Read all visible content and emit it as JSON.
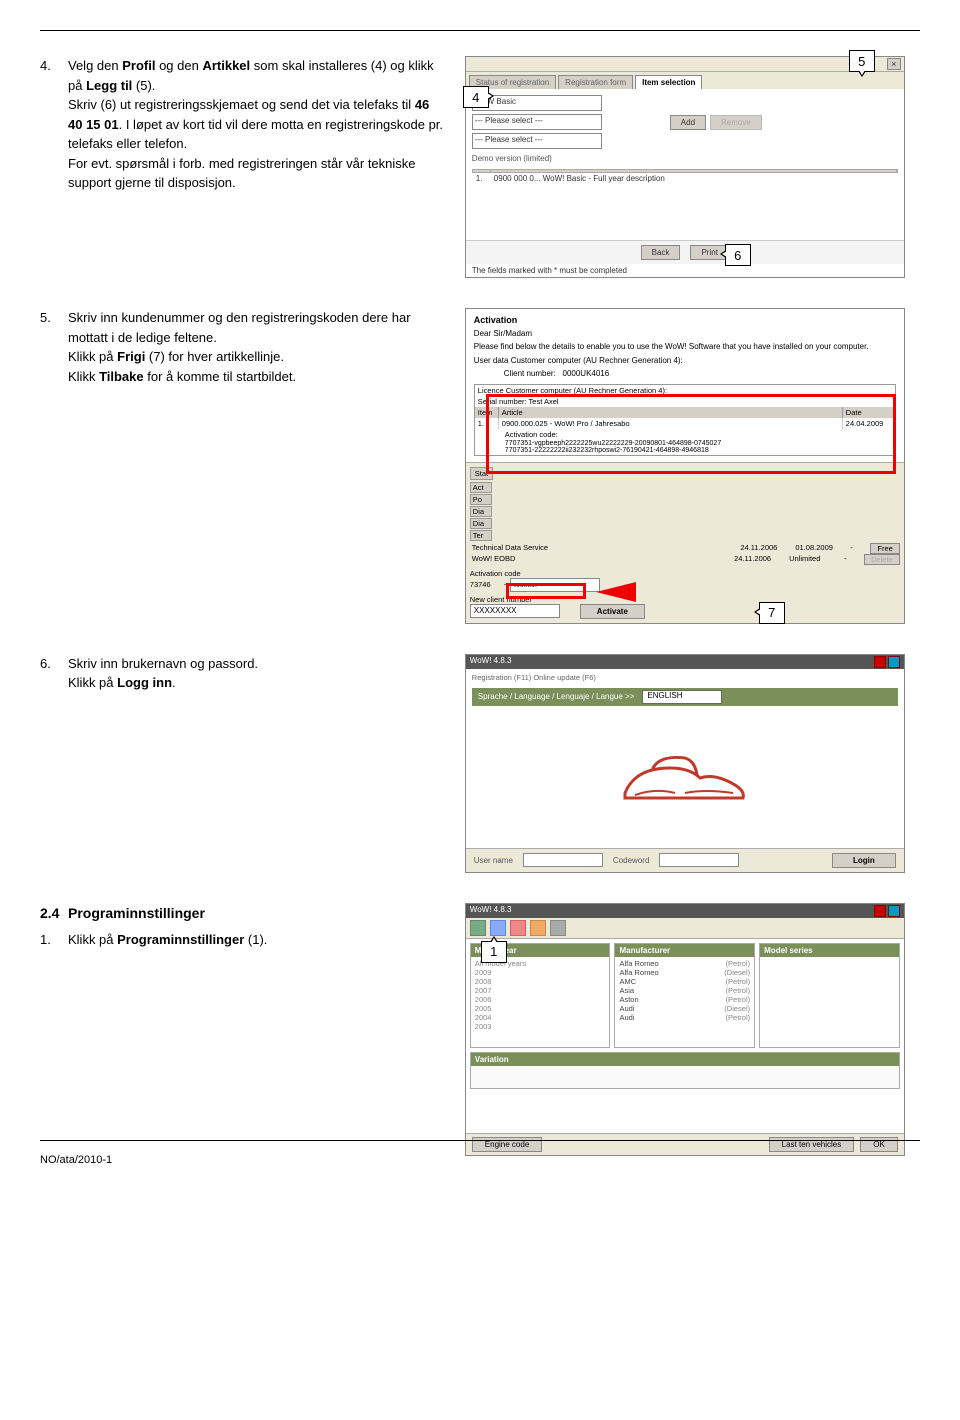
{
  "step4": {
    "num": "4.",
    "text_pre": "Velg den ",
    "b1": "Profil",
    "mid1": " og den ",
    "b2": "Artikkel",
    "mid2": " som skal installeres (4) og klikk på ",
    "b3": "Legg til",
    "mid3": " (5).",
    "line2a": "Skriv (6) ut registreringsskjemaet og send det via telefaks til ",
    "b4": "46 40 15 01",
    "line2b": ". I løpet av kort tid vil dere motta en registreringskode pr. telefaks eller telefon.",
    "line3": "For evt. spørsmål i forb. med registreringen står vår tekniske support gjerne til disposisjon."
  },
  "shot1": {
    "tab1": "Status of registration",
    "tab2": "Registration form",
    "tab3": "Item selection",
    "sel1": "WoW Basic",
    "sel2": "--- Please select ---",
    "sel3": "--- Please select ---",
    "demo": "Demo version (limited)",
    "add": "Add",
    "remove": "Remove",
    "th_idx": "",
    "th_art": "0900 000 0... WoW! Basic - Full year description",
    "idx1": "1.",
    "back": "Back",
    "print": "Print",
    "note": "The fields marked with * must be completed",
    "c4": "4",
    "c5": "5",
    "c6": "6"
  },
  "step5": {
    "num": "5.",
    "line1": "Skriv inn kundenummer og den registreringskoden dere har mottatt i de ledige feltene.",
    "line2a": "Klikk på ",
    "b1": "Frigi",
    "line2b": " (7) for hver artikkellinje.",
    "line3a": "Klikk ",
    "b2": "Tilbake",
    "line3b": " for å komme til startbildet."
  },
  "shot2": {
    "title": "Activation",
    "greet": "Dear Sir/Madam",
    "p1": "Please find below the details to enable you to use the WoW! Software that you have installed on your computer.",
    "p2": "User data Customer computer (AU Rechner Generation 4):",
    "clientnum_l": "Client number:",
    "clientnum_v": "0000UK4016",
    "lic": "Licence Customer computer (AU Rechner Generation 4):",
    "serial": "Serial number: Test Axel",
    "th_item": "Item",
    "th_art": "Article",
    "th_date": "Date",
    "row1_i": "1.",
    "row1_a": "0900.000.025 - WoW! Pro / Jahresabo",
    "row1_d": "24.04.2009",
    "actcode_l": "Activation code:",
    "actcode1": "7707351-vgpbeeph2222225wu22222229-20090801-464898-0745027",
    "actcode2": "7707351-22222222ii232232rhposwi2-76190421-464898-4946818",
    "greytab_stat": "Stat",
    "greytab_act": "Act",
    "greytab_po": "Po",
    "greytab_dia": "Dia",
    "greytab_dia2": "Dia",
    "greytab_ter": "Ter",
    "row_tds": "Technical Data Service",
    "row_tds_d1": "24.11.2006",
    "row_tds_d2": "01.08.2009",
    "row_tds_d3": "-",
    "row_wow": "WoW! EOBD",
    "row_wow_d1": "24.11.2006",
    "row_wow_d2": "Unlimited",
    "row_wow_d3": "-",
    "activation_l": "Activation code",
    "act_val": "73746",
    "xxxxx": "xxxxxx",
    "newnum": "New client number",
    "newnum_v": "XXXXXXXX",
    "activate": "Activate",
    "c7": "7",
    "freebtn": "Free",
    "delbtn": "Delete"
  },
  "step6": {
    "num": "6.",
    "line1": "Skriv inn brukernavn og passord.",
    "line2a": "Klikk på ",
    "b1": "Logg inn",
    "line2b": "."
  },
  "shot3": {
    "tb": "WoW! 4.8.3",
    "crumb": "Registration (F11) Online update (F6)",
    "langlabel": "Sprache / Language / Lenguaje / Langue >>",
    "langval": "ENGLISH",
    "user": "User name",
    "code": "Codeword",
    "login": "Login"
  },
  "sec24": {
    "numhead": "2.4",
    "head": "Programinnstillinger",
    "num": "1.",
    "line_a": "Klikk på ",
    "b1": "Programinnstillinger",
    "line_b": " (1)."
  },
  "shot4": {
    "tb": "WoW! 4.8.3",
    "c1": "1",
    "col1h": "Model year",
    "col2h": "Manufacturer",
    "col3h": "Model series",
    "col4h": "Variation",
    "y_all": "All model years",
    "years": [
      "2009",
      "2008",
      "2007",
      "2006",
      "2005",
      "2004",
      "2003"
    ],
    "mfr": [
      [
        "Alfa Romeo",
        "(Petrol)"
      ],
      [
        "Alfa Romeo",
        "(Diesel)"
      ],
      [
        "AMC",
        "(Petrol)"
      ],
      [
        "Asia",
        "(Petrol)"
      ],
      [
        "Aston",
        "(Petrol)"
      ],
      [
        "Audi",
        "(Diesel)"
      ],
      [
        "Audi",
        "(Petrol)"
      ]
    ],
    "engine": "Engine code",
    "lastten": "Last ten vehicles",
    "ok": "OK"
  },
  "footer": "NO/ata/2010-1"
}
